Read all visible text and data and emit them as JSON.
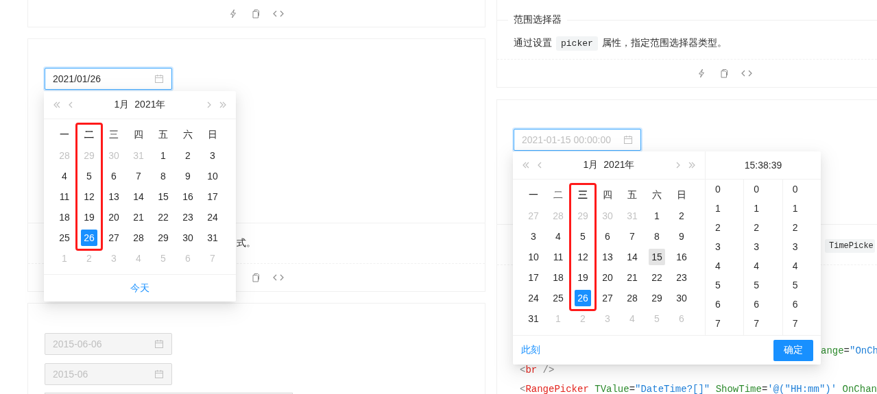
{
  "left_column": {
    "date_card": {
      "date_input": {
        "value": "2021/01/26",
        "focused": true,
        "disabled": false
      },
      "description_tail": "式。"
    },
    "disabled_card": {
      "inputs": [
        {
          "value": "2015-06-06",
          "focused": false,
          "disabled": true
        },
        {
          "value": "2015-06",
          "focused": false,
          "disabled": true
        }
      ]
    },
    "date_popup": {
      "month": "1月",
      "year": "2021年",
      "weekdays": [
        {
          "label": "一",
          "highlighted": false
        },
        {
          "label": "二",
          "highlighted": true
        },
        {
          "label": "三",
          "highlighted": false
        },
        {
          "label": "四",
          "highlighted": false
        },
        {
          "label": "五",
          "highlighted": false
        },
        {
          "label": "六",
          "highlighted": false
        },
        {
          "label": "日",
          "highlighted": false
        }
      ],
      "weeks": [
        [
          {
            "day": "28",
            "in_month": false,
            "selected": false,
            "hovered": false
          },
          {
            "day": "29",
            "in_month": false,
            "selected": false,
            "hovered": false
          },
          {
            "day": "30",
            "in_month": false,
            "selected": false,
            "hovered": false
          },
          {
            "day": "31",
            "in_month": false,
            "selected": false,
            "hovered": false
          },
          {
            "day": "1",
            "in_month": true,
            "selected": false,
            "hovered": false
          },
          {
            "day": "2",
            "in_month": true,
            "selected": false,
            "hovered": false
          },
          {
            "day": "3",
            "in_month": true,
            "selected": false,
            "hovered": false
          }
        ],
        [
          {
            "day": "4",
            "in_month": true,
            "selected": false,
            "hovered": false
          },
          {
            "day": "5",
            "in_month": true,
            "selected": false,
            "hovered": false
          },
          {
            "day": "6",
            "in_month": true,
            "selected": false,
            "hovered": false
          },
          {
            "day": "7",
            "in_month": true,
            "selected": false,
            "hovered": false
          },
          {
            "day": "8",
            "in_month": true,
            "selected": false,
            "hovered": false
          },
          {
            "day": "9",
            "in_month": true,
            "selected": false,
            "hovered": false
          },
          {
            "day": "10",
            "in_month": true,
            "selected": false,
            "hovered": false
          }
        ],
        [
          {
            "day": "11",
            "in_month": true,
            "selected": false,
            "hovered": false
          },
          {
            "day": "12",
            "in_month": true,
            "selected": false,
            "hovered": false
          },
          {
            "day": "13",
            "in_month": true,
            "selected": false,
            "hovered": false
          },
          {
            "day": "14",
            "in_month": true,
            "selected": false,
            "hovered": false
          },
          {
            "day": "15",
            "in_month": true,
            "selected": false,
            "hovered": false
          },
          {
            "day": "16",
            "in_month": true,
            "selected": false,
            "hovered": false
          },
          {
            "day": "17",
            "in_month": true,
            "selected": false,
            "hovered": false
          }
        ],
        [
          {
            "day": "18",
            "in_month": true,
            "selected": false,
            "hovered": false
          },
          {
            "day": "19",
            "in_month": true,
            "selected": false,
            "hovered": false
          },
          {
            "day": "20",
            "in_month": true,
            "selected": false,
            "hovered": false
          },
          {
            "day": "21",
            "in_month": true,
            "selected": false,
            "hovered": false
          },
          {
            "day": "22",
            "in_month": true,
            "selected": false,
            "hovered": false
          },
          {
            "day": "23",
            "in_month": true,
            "selected": false,
            "hovered": false
          },
          {
            "day": "24",
            "in_month": true,
            "selected": false,
            "hovered": false
          }
        ],
        [
          {
            "day": "25",
            "in_month": true,
            "selected": false,
            "hovered": false
          },
          {
            "day": "26",
            "in_month": true,
            "selected": true,
            "hovered": false
          },
          {
            "day": "27",
            "in_month": true,
            "selected": false,
            "hovered": false
          },
          {
            "day": "28",
            "in_month": true,
            "selected": false,
            "hovered": false
          },
          {
            "day": "29",
            "in_month": true,
            "selected": false,
            "hovered": false
          },
          {
            "day": "30",
            "in_month": true,
            "selected": false,
            "hovered": false
          },
          {
            "day": "31",
            "in_month": true,
            "selected": false,
            "hovered": false
          }
        ],
        [
          {
            "day": "1",
            "in_month": false,
            "selected": false,
            "hovered": false
          },
          {
            "day": "2",
            "in_month": false,
            "selected": false,
            "hovered": false
          },
          {
            "day": "3",
            "in_month": false,
            "selected": false,
            "hovered": false
          },
          {
            "day": "4",
            "in_month": false,
            "selected": false,
            "hovered": false
          },
          {
            "day": "5",
            "in_month": false,
            "selected": false,
            "hovered": false
          },
          {
            "day": "6",
            "in_month": false,
            "selected": false,
            "hovered": false
          },
          {
            "day": "7",
            "in_month": false,
            "selected": false,
            "hovered": false
          }
        ]
      ],
      "today_link": "今天"
    }
  },
  "right_column": {
    "range_card": {
      "title": "范围选择器",
      "description_before": "通过设置",
      "description_code": "picker",
      "description_after": "属性，指定范围选择器类型。"
    },
    "time_card": {
      "datetime_input": {
        "value": "2021-01-15 00:00:00",
        "preview": true,
        "focused": true
      },
      "description_code": "TimePicke",
      "code_lines": [
        [
          {
            "text": "ange",
            "kind": "attr"
          },
          {
            "text": "=",
            "kind": "plain"
          },
          {
            "text": "\"OnCh",
            "kind": "value"
          }
        ],
        [
          {
            "text": "<",
            "kind": "punct"
          },
          {
            "text": "br",
            "kind": "tag"
          },
          {
            "text": " />",
            "kind": "punct"
          }
        ],
        [
          {
            "text": "<",
            "kind": "punct"
          },
          {
            "text": "RangePicker",
            "kind": "tag"
          },
          {
            "text": " TValue",
            "kind": "attr"
          },
          {
            "text": "=",
            "kind": "plain"
          },
          {
            "text": "\"DateTime?[]\"",
            "kind": "value"
          },
          {
            "text": " ShowTime",
            "kind": "attr"
          },
          {
            "text": "=",
            "kind": "plain"
          },
          {
            "text": "'@(\"HH:mm\")'",
            "kind": "value"
          },
          {
            "text": " OnChan",
            "kind": "attr"
          }
        ]
      ]
    },
    "datetime_popup": {
      "month": "1月",
      "year": "2021年",
      "weekdays": [
        {
          "label": "一",
          "highlighted": false
        },
        {
          "label": "二",
          "highlighted": false
        },
        {
          "label": "三",
          "highlighted": true
        },
        {
          "label": "四",
          "highlighted": false
        },
        {
          "label": "五",
          "highlighted": false
        },
        {
          "label": "六",
          "highlighted": false
        },
        {
          "label": "日",
          "highlighted": false
        }
      ],
      "weeks": [
        [
          {
            "day": "27",
            "in_month": false,
            "selected": false,
            "hovered": false
          },
          {
            "day": "28",
            "in_month": false,
            "selected": false,
            "hovered": false
          },
          {
            "day": "29",
            "in_month": false,
            "selected": false,
            "hovered": false
          },
          {
            "day": "30",
            "in_month": false,
            "selected": false,
            "hovered": false
          },
          {
            "day": "31",
            "in_month": false,
            "selected": false,
            "hovered": false
          },
          {
            "day": "1",
            "in_month": true,
            "selected": false,
            "hovered": false
          },
          {
            "day": "2",
            "in_month": true,
            "selected": false,
            "hovered": false
          }
        ],
        [
          {
            "day": "3",
            "in_month": true,
            "selected": false,
            "hovered": false
          },
          {
            "day": "4",
            "in_month": true,
            "selected": false,
            "hovered": false
          },
          {
            "day": "5",
            "in_month": true,
            "selected": false,
            "hovered": false
          },
          {
            "day": "6",
            "in_month": true,
            "selected": false,
            "hovered": false
          },
          {
            "day": "7",
            "in_month": true,
            "selected": false,
            "hovered": false
          },
          {
            "day": "8",
            "in_month": true,
            "selected": false,
            "hovered": false
          },
          {
            "day": "9",
            "in_month": true,
            "selected": false,
            "hovered": false
          }
        ],
        [
          {
            "day": "10",
            "in_month": true,
            "selected": false,
            "hovered": false
          },
          {
            "day": "11",
            "in_month": true,
            "selected": false,
            "hovered": false
          },
          {
            "day": "12",
            "in_month": true,
            "selected": false,
            "hovered": false
          },
          {
            "day": "13",
            "in_month": true,
            "selected": false,
            "hovered": false
          },
          {
            "day": "14",
            "in_month": true,
            "selected": false,
            "hovered": false
          },
          {
            "day": "15",
            "in_month": true,
            "selected": false,
            "hovered": true
          },
          {
            "day": "16",
            "in_month": true,
            "selected": false,
            "hovered": false
          }
        ],
        [
          {
            "day": "17",
            "in_month": true,
            "selected": false,
            "hovered": false
          },
          {
            "day": "18",
            "in_month": true,
            "selected": false,
            "hovered": false
          },
          {
            "day": "19",
            "in_month": true,
            "selected": false,
            "hovered": false
          },
          {
            "day": "20",
            "in_month": true,
            "selected": false,
            "hovered": false
          },
          {
            "day": "21",
            "in_month": true,
            "selected": false,
            "hovered": false
          },
          {
            "day": "22",
            "in_month": true,
            "selected": false,
            "hovered": false
          },
          {
            "day": "23",
            "in_month": true,
            "selected": false,
            "hovered": false
          }
        ],
        [
          {
            "day": "24",
            "in_month": true,
            "selected": false,
            "hovered": false
          },
          {
            "day": "25",
            "in_month": true,
            "selected": false,
            "hovered": false
          },
          {
            "day": "26",
            "in_month": true,
            "selected": true,
            "hovered": false
          },
          {
            "day": "27",
            "in_month": true,
            "selected": false,
            "hovered": false
          },
          {
            "day": "28",
            "in_month": true,
            "selected": false,
            "hovered": false
          },
          {
            "day": "29",
            "in_month": true,
            "selected": false,
            "hovered": false
          },
          {
            "day": "30",
            "in_month": true,
            "selected": false,
            "hovered": false
          }
        ],
        [
          {
            "day": "31",
            "in_month": true,
            "selected": false,
            "hovered": false
          },
          {
            "day": "1",
            "in_month": false,
            "selected": false,
            "hovered": false
          },
          {
            "day": "2",
            "in_month": false,
            "selected": false,
            "hovered": false
          },
          {
            "day": "3",
            "in_month": false,
            "selected": false,
            "hovered": false
          },
          {
            "day": "4",
            "in_month": false,
            "selected": false,
            "hovered": false
          },
          {
            "day": "5",
            "in_month": false,
            "selected": false,
            "hovered": false
          },
          {
            "day": "6",
            "in_month": false,
            "selected": false,
            "hovered": false
          }
        ]
      ],
      "time": "15:38:39",
      "time_columns": [
        [
          "0",
          "1",
          "2",
          "3",
          "4",
          "5",
          "6",
          "7"
        ],
        [
          "0",
          "1",
          "2",
          "3",
          "4",
          "5",
          "6",
          "7"
        ],
        [
          "0",
          "1",
          "2",
          "3",
          "4",
          "5",
          "6",
          "7"
        ]
      ],
      "now_link": "此刻",
      "ok_button": "确定"
    }
  }
}
